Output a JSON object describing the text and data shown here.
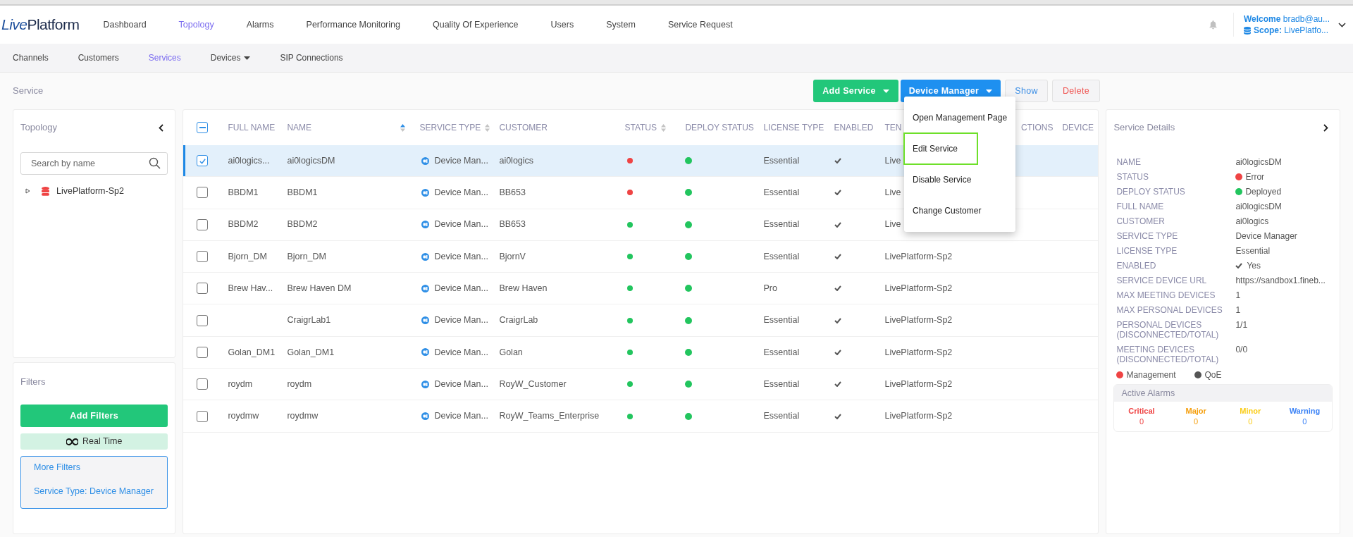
{
  "logo": [
    "Live",
    "Platform"
  ],
  "nav": [
    {
      "label": "Dashboard",
      "selected": false
    },
    {
      "label": "Topology",
      "selected": true
    },
    {
      "label": "Alarms",
      "selected": false
    },
    {
      "label": "Performance Monitoring",
      "selected": false
    },
    {
      "label": "Quality Of Experience",
      "selected": false
    },
    {
      "label": "Users",
      "selected": false
    },
    {
      "label": "System",
      "selected": false
    },
    {
      "label": "Service Request",
      "selected": false
    }
  ],
  "user": {
    "welcome_label": "Welcome",
    "welcome_value": "bradb@au...",
    "scope_label": "Scope:",
    "scope_value": "LivePlatfo..."
  },
  "subnav": [
    {
      "label": "Channels",
      "selected": false,
      "dropdown": false
    },
    {
      "label": "Customers",
      "selected": false,
      "dropdown": false
    },
    {
      "label": "Services",
      "selected": true,
      "dropdown": false
    },
    {
      "label": "Devices",
      "selected": false,
      "dropdown": true
    },
    {
      "label": "SIP Connections",
      "selected": false,
      "dropdown": false
    }
  ],
  "page_title": "Service",
  "actions": [
    {
      "label": "Add Service",
      "kind": "success",
      "dropdown": true
    },
    {
      "label": "Device Manager",
      "kind": "primary",
      "dropdown": true
    },
    {
      "label": "Show",
      "kind": "plain",
      "dropdown": false
    },
    {
      "label": "Delete",
      "kind": "danger",
      "dropdown": false
    }
  ],
  "menu": [
    {
      "label": "Open Management Page",
      "selected": false
    },
    {
      "label": "Edit Service",
      "selected": true
    },
    {
      "label": "Disable Service",
      "selected": false
    },
    {
      "label": "Change Customer",
      "selected": false
    }
  ],
  "topology": {
    "title": "Topology",
    "search": {
      "placeholder": "Search by name"
    },
    "tree": [
      {
        "label": "LivePlatform-Sp2",
        "expanded": false
      }
    ]
  },
  "filters": {
    "title": "Filters",
    "add_button": "Add Filters",
    "realtime": "Real Time",
    "more": "More Filters",
    "active": [
      "Service Type: Device Manager"
    ]
  },
  "table": {
    "select_all_indeterminate": true,
    "columns": [
      {
        "label": "FULL NAME"
      },
      {
        "label": "NAME",
        "sorted": true
      },
      {
        "label": "SERVICE TYPE",
        "sorted": false
      },
      {
        "label": "CUSTOMER"
      },
      {
        "label": "STATUS",
        "sorted": false
      },
      {
        "label": "DEPLOY STATUS"
      },
      {
        "label": "LICENSE TYPE"
      },
      {
        "label": "ENABLED"
      },
      {
        "label": "TEN"
      },
      {
        "label": "CTIONS"
      },
      {
        "label": "DEVICE"
      }
    ],
    "rows": [
      {
        "selected": true,
        "full_name": "ai0logics...",
        "name": "ai0logicsDM",
        "service_type": "Device Man...",
        "customer": "ai0logics",
        "status": {
          "color": "#ef4444"
        },
        "deploy_status": {
          "color": "#22c55e"
        },
        "license": "Essential",
        "enabled": true,
        "tenant": "Live"
      },
      {
        "selected": false,
        "full_name": "BBDM1",
        "name": "BBDM1",
        "service_type": "Device Man...",
        "customer": "BB653",
        "status": {
          "color": "#ef4444"
        },
        "deploy_status": {
          "color": "#22c55e"
        },
        "license": "Essential",
        "enabled": true,
        "tenant": "Live"
      },
      {
        "selected": false,
        "full_name": "BBDM2",
        "name": "BBDM2",
        "service_type": "Device Man...",
        "customer": "BB653",
        "status": {
          "color": "#22c55e"
        },
        "deploy_status": {
          "color": "#22c55e"
        },
        "license": "Essential",
        "enabled": true,
        "tenant": "Live"
      },
      {
        "selected": false,
        "full_name": "Bjorn_DM",
        "name": "Bjorn_DM",
        "service_type": "Device Man...",
        "customer": "BjornV",
        "status": {
          "color": "#22c55e"
        },
        "deploy_status": {
          "color": "#22c55e"
        },
        "license": "Essential",
        "enabled": true,
        "tenant": "LivePlatform-Sp2"
      },
      {
        "selected": false,
        "full_name": "Brew Hav...",
        "name": "Brew Haven DM",
        "service_type": "Device Man...",
        "customer": "Brew Haven",
        "status": {
          "color": "#22c55e"
        },
        "deploy_status": {
          "color": "#22c55e"
        },
        "license": "Pro",
        "enabled": true,
        "tenant": "LivePlatform-Sp2"
      },
      {
        "selected": false,
        "name": "CraigrLab1",
        "service_type": "Device Man...",
        "customer": "CraigrLab",
        "status": {
          "color": "#22c55e"
        },
        "deploy_status": {
          "color": "#22c55e"
        },
        "license": "Essential",
        "enabled": true,
        "tenant": "LivePlatform-Sp2"
      },
      {
        "selected": false,
        "full_name": "Golan_DM1",
        "name": "Golan_DM1",
        "service_type": "Device Man...",
        "customer": "Golan",
        "status": {
          "color": "#22c55e"
        },
        "deploy_status": {
          "color": "#22c55e"
        },
        "license": "Essential",
        "enabled": true,
        "tenant": "LivePlatform-Sp2"
      },
      {
        "selected": false,
        "full_name": "roydm",
        "name": "roydm",
        "service_type": "Device Man...",
        "customer": "RoyW_Customer",
        "status": {
          "color": "#22c55e"
        },
        "deploy_status": {
          "color": "#22c55e"
        },
        "license": "Essential",
        "enabled": true,
        "tenant": "LivePlatform-Sp2"
      },
      {
        "selected": false,
        "full_name": "roydmw",
        "name": "roydmw",
        "service_type": "Device Man...",
        "customer": "RoyW_Teams_Enterprise",
        "status": {
          "color": "#22c55e"
        },
        "deploy_status": {
          "color": "#22c55e"
        },
        "license": "Essential",
        "enabled": true,
        "tenant": "LivePlatform-Sp2"
      }
    ]
  },
  "details": {
    "title": "Service Details",
    "fields": [
      {
        "label": "NAME",
        "value": "ai0logicsDM"
      },
      {
        "label": "STATUS",
        "value": "Error",
        "color": "#ef4444"
      },
      {
        "label": "DEPLOY STATUS",
        "value": "Deployed",
        "color": "#22c55e"
      },
      {
        "label": "FULL NAME",
        "value": "ai0logicsDM"
      },
      {
        "label": "CUSTOMER",
        "value": "ai0logics"
      },
      {
        "label": "SERVICE TYPE",
        "value": "Device Manager"
      },
      {
        "label": "LICENSE TYPE",
        "value": "Essential"
      },
      {
        "label": "ENABLED",
        "value": "Yes",
        "checked": true
      },
      {
        "label": "SERVICE DEVICE URL",
        "value": "https://sandbox1.fineb..."
      },
      {
        "label": "MAX MEETING DEVICES",
        "value": "1"
      },
      {
        "label": "MAX PERSONAL DEVICES",
        "value": "1"
      },
      {
        "label": "PERSONAL DEVICES (DISCONNECTED/TOTAL)",
        "value": "1/1"
      },
      {
        "label": "MEETING DEVICES (DISCONNECTED/TOTAL)",
        "value": "0/0"
      }
    ],
    "legend": [
      {
        "label": "Management",
        "color": "#ef4444"
      },
      {
        "label": "QoE",
        "color": "#555555"
      }
    ],
    "alarms_title": "Active Alarms",
    "alarms": [
      {
        "label": "Critical",
        "count": "0",
        "color": "#ef4444"
      },
      {
        "label": "Major",
        "count": "0",
        "color": "#f59e0b"
      },
      {
        "label": "Minor",
        "count": "0",
        "color": "#facc15"
      },
      {
        "label": "Warning",
        "count": "0",
        "color": "#3b82f6"
      }
    ]
  }
}
